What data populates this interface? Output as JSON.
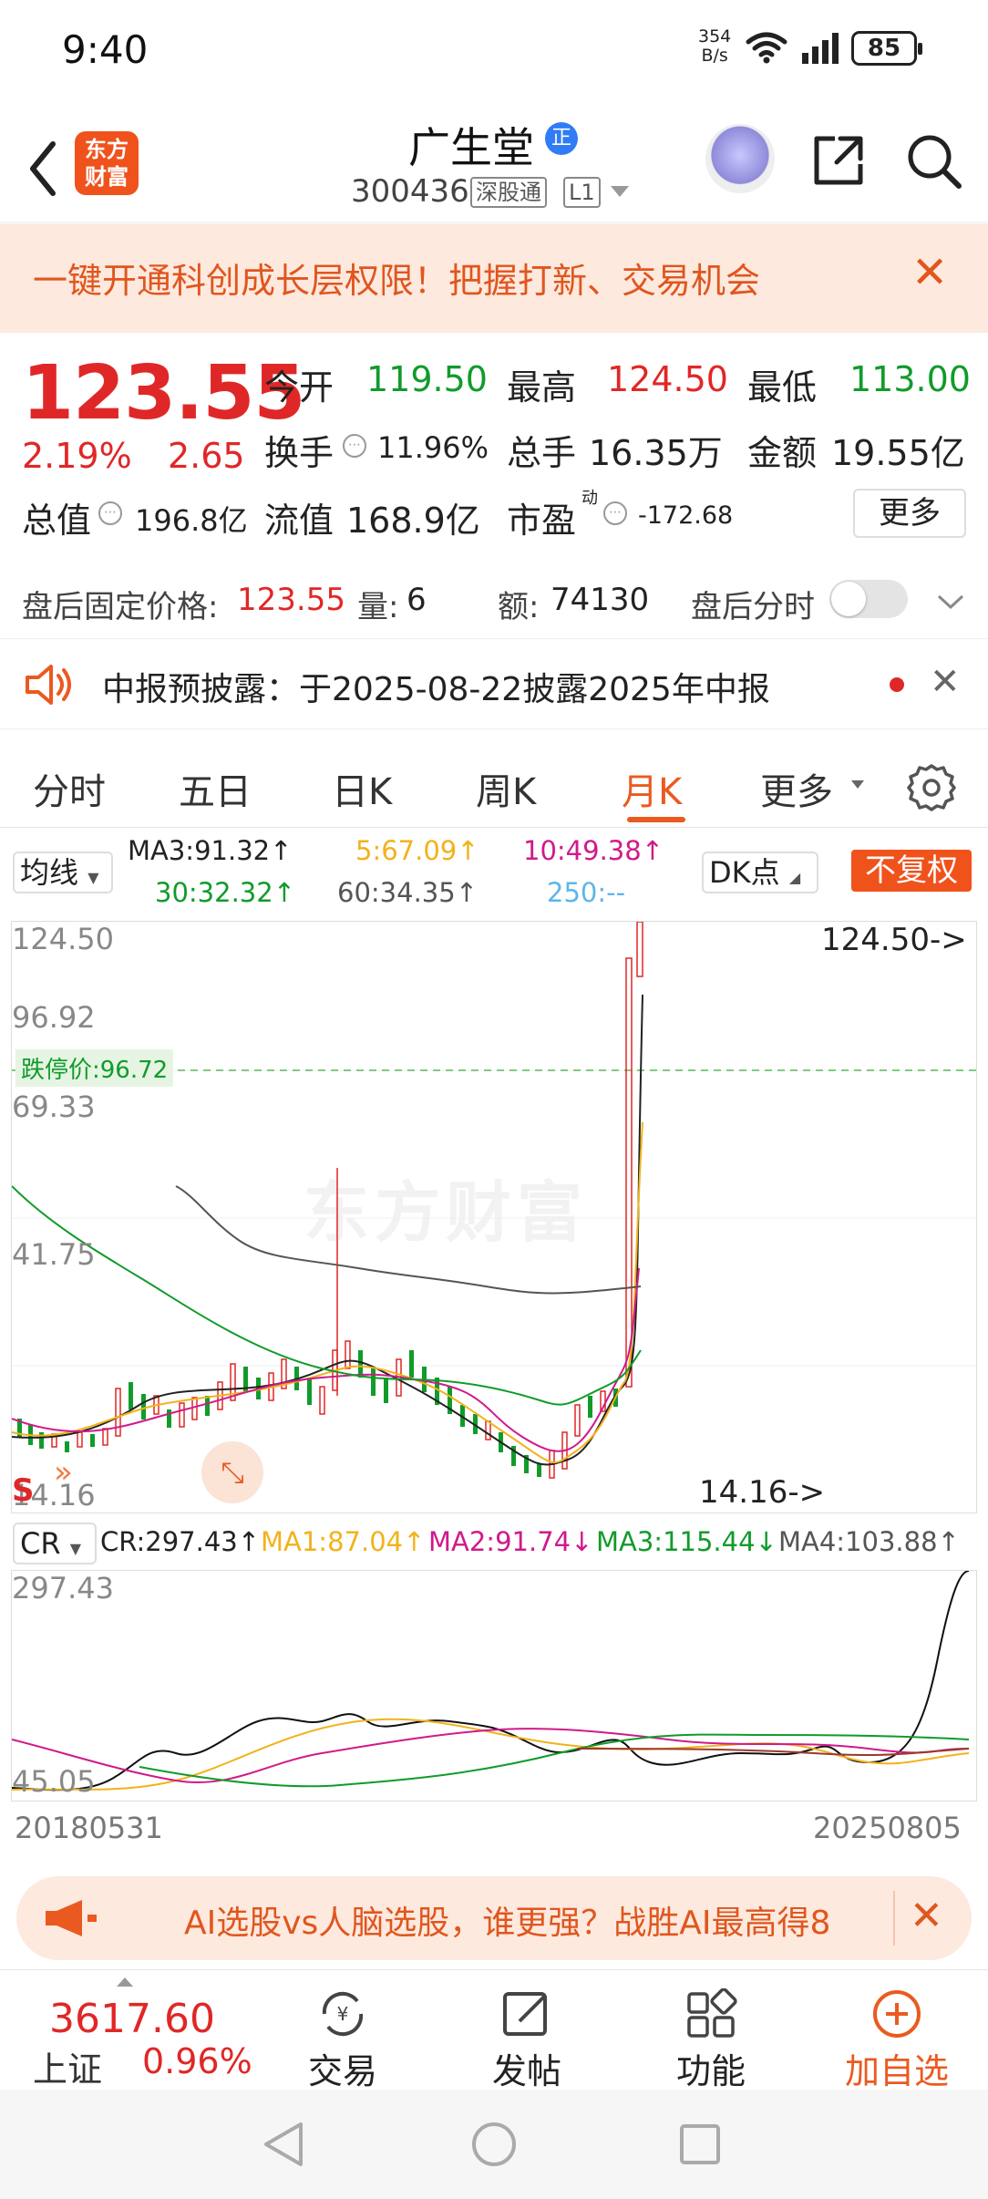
{
  "status": {
    "time": "9:40",
    "speed_top": "354",
    "speed_bottom": "B/s",
    "battery": "85"
  },
  "header": {
    "logo_line1": "东方",
    "logo_line2": "财富",
    "name": "广生堂",
    "verify_badge": "正",
    "code": "300436",
    "tag1": "深股通",
    "tag2": "L1"
  },
  "promo": {
    "text": "一键开通科创成长层权限！把握打新、交易机会"
  },
  "quote": {
    "price": "123.55",
    "pct": "2.19%",
    "chg": "2.65",
    "open_label": "今开",
    "open": "119.50",
    "high_label": "最高",
    "high": "124.50",
    "low_label": "最低",
    "low": "113.00",
    "turnover_label": "换手",
    "turnover": "11.96%",
    "volume_label": "总手",
    "volume": "16.35万",
    "amount_label": "金额",
    "amount": "19.55亿",
    "mcap_label": "总值",
    "mcap": "196.8亿",
    "float_label": "流值",
    "float": "168.9亿",
    "pe_label": "市盈",
    "pe_sup": "动",
    "pe": "-172.68",
    "more": "更多"
  },
  "afterhours": {
    "label": "盘后固定价格:",
    "price": "123.55",
    "vol_label": "量:",
    "vol": "6",
    "amt_label": "额:",
    "amt": "74130",
    "toggle_label": "盘后分时"
  },
  "notice": {
    "text": "中报预披露：于2025-08-22披露2025年中报"
  },
  "tabs": [
    "分时",
    "五日",
    "日K",
    "周K",
    "月K",
    "更多"
  ],
  "indicators": {
    "ma_select": "均线",
    "ma3": "MA3:91.32↑",
    "ma5": "5:67.09↑",
    "ma10": "10:49.38↑",
    "ma30": "30:32.32↑",
    "ma60": "60:34.35↑",
    "ma250": "250:--",
    "dk": "DK点",
    "fq": "不复权"
  },
  "kchart": {
    "y_labels": [
      "124.50",
      "96.92",
      "69.33",
      "41.75",
      "14.16"
    ],
    "limit_down": "跌停价:96.72",
    "high_mark": "124.50->",
    "low_mark": "14.16->",
    "watermark": "东方财富"
  },
  "cr": {
    "select": "CR",
    "cr": "CR:297.43↑",
    "ma1": "MA1:87.04↑",
    "ma2": "MA2:91.74↓",
    "ma3": "MA3:115.44↓",
    "ma4": "MA4:103.88↑",
    "y_top": "297.43",
    "y_bottom": "45.05",
    "x_start": "20180531",
    "x_end": "20250805"
  },
  "ad": {
    "text": "AI选股vs人脑选股，谁更强？战胜AI最高得8"
  },
  "bottomnav": {
    "index_value": "3617.60",
    "index_name": "上证",
    "index_pct": "0.96%",
    "trade": "交易",
    "post": "发帖",
    "func": "功能",
    "add": "加自选"
  },
  "colors": {
    "up": "#e02727",
    "down": "#119b2b",
    "accent": "#ea5a20"
  }
}
